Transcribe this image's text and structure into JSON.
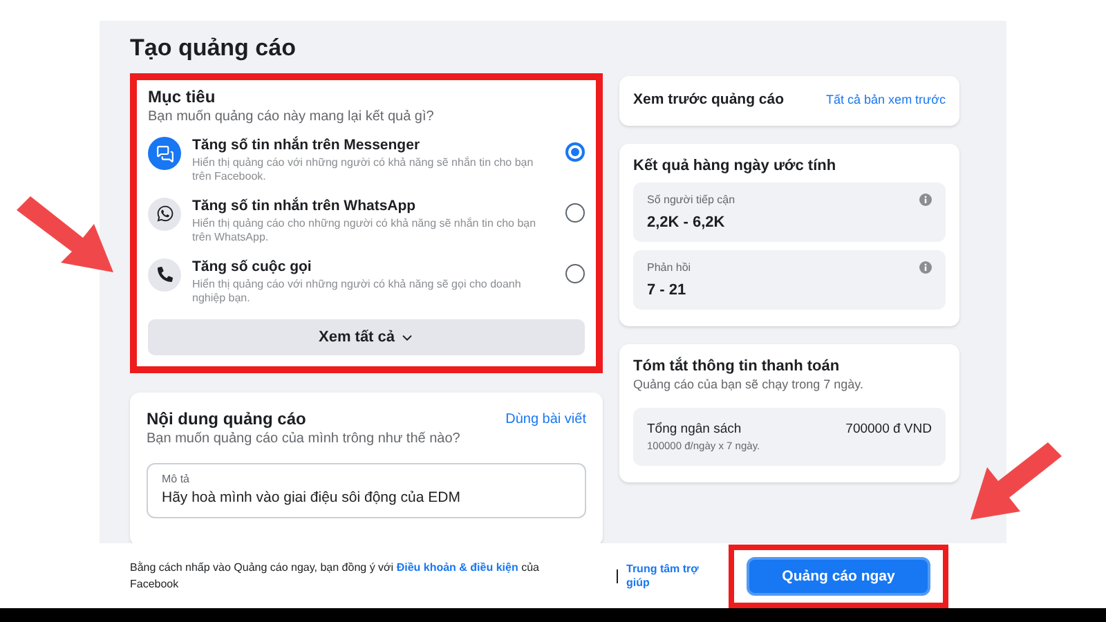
{
  "title": "Tạo quảng cáo",
  "objective": {
    "title": "Mục tiêu",
    "subtitle": "Bạn muốn quảng cáo này mang lại kết quả gì?",
    "see_all": "Xem tất cả",
    "options": [
      {
        "kind": "messenger",
        "title": "Tăng số tin nhắn trên Messenger",
        "description": "Hiển thị quảng cáo với những người có khả năng sẽ nhắn tin cho bạn trên Facebook.",
        "selected": true
      },
      {
        "kind": "whatsapp",
        "title": "Tăng số tin nhắn trên WhatsApp",
        "description": "Hiển thị quảng cáo cho những người có khả năng sẽ nhắn tin cho bạn trên WhatsApp.",
        "selected": false
      },
      {
        "kind": "phone",
        "title": "Tăng số cuộc gọi",
        "description": "Hiển thị quảng cáo với những người có khả năng sẽ gọi cho doanh nghiệp bạn.",
        "selected": false
      }
    ]
  },
  "content": {
    "title": "Nội dung quảng cáo",
    "link": "Dùng bài viết",
    "subtitle": "Bạn muốn quảng cáo của mình trông như thế nào?",
    "field": {
      "label": "Mô tả",
      "value": "Hãy hoà mình vào giai điệu sôi động của EDM"
    }
  },
  "preview": {
    "title": "Xem trước quảng cáo",
    "link": "Tất cả bản xem trước"
  },
  "estimate": {
    "title": "Kết quả hàng ngày ước tính",
    "metrics": [
      {
        "label": "Số người tiếp cận",
        "value": "2,2K - 6,2K"
      },
      {
        "label": "Phản hồi",
        "value": "7 - 21"
      }
    ]
  },
  "billing": {
    "title": "Tóm tắt thông tin thanh toán",
    "subtitle": "Quảng cáo của bạn sẽ chạy trong 7 ngày.",
    "total_label": "Tổng ngân sách",
    "total_detail": "100000 đ/ngày x 7 ngày.",
    "total_value": "700000 đ VND"
  },
  "footer": {
    "text_before": "Bằng cách nhấp vào Quảng cáo ngay, bạn đồng ý với",
    "link": "Điều khoản & điều kiện",
    "text_after": "của Facebook",
    "help": "Trung tâm trợ giúp",
    "button": "Quảng cáo ngay"
  }
}
